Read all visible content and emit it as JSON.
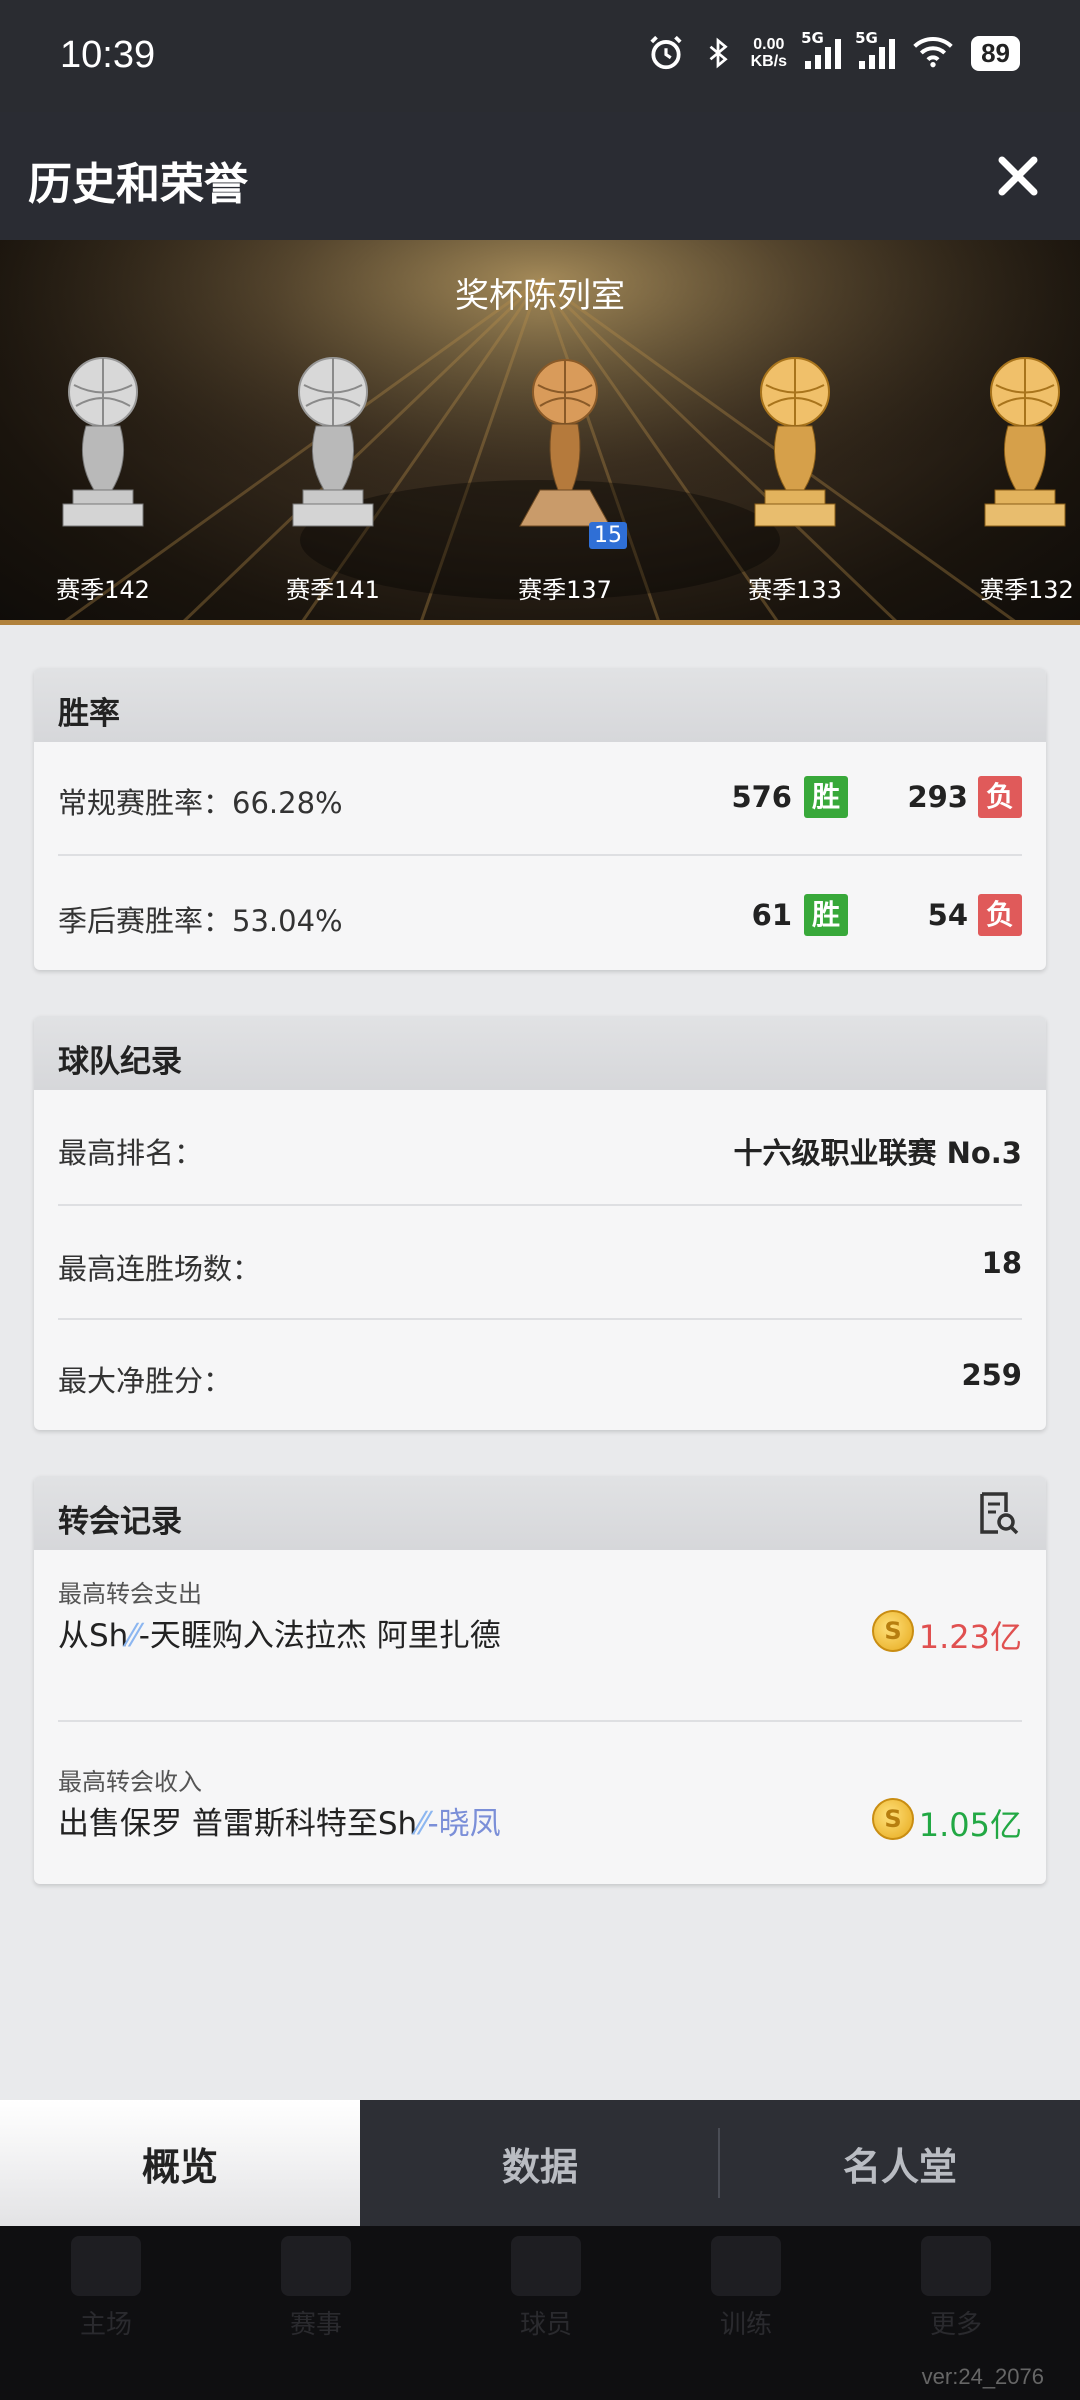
{
  "status": {
    "time": "10:39",
    "net_speed_value": "0.00",
    "net_speed_unit": "KB/s",
    "sim1": "5G",
    "sim2": "5G",
    "battery": "89"
  },
  "header": {
    "title": "历史和荣誉"
  },
  "banner": {
    "title": "奖杯陈列室",
    "trophies": [
      {
        "label": "赛季142",
        "type": "silver"
      },
      {
        "label": "赛季141",
        "type": "silver"
      },
      {
        "label": "赛季137",
        "type": "bronze",
        "badge": "15"
      },
      {
        "label": "赛季133",
        "type": "gold"
      },
      {
        "label": "赛季132",
        "type": "gold"
      }
    ]
  },
  "winrate": {
    "title": "胜率",
    "rows": [
      {
        "label": "常规赛胜率：66.28%",
        "wins": "576",
        "win_tag": "胜",
        "losses": "293",
        "loss_tag": "负"
      },
      {
        "label": "季后赛胜率：53.04%",
        "wins": "61",
        "win_tag": "胜",
        "losses": "54",
        "loss_tag": "负"
      }
    ]
  },
  "records": {
    "title": "球队纪录",
    "rows": [
      {
        "label": "最高排名：",
        "value": "十六级职业联赛 No.3"
      },
      {
        "label": "最高连胜场数：",
        "value": "18"
      },
      {
        "label": "最大净胜分：",
        "value": "259"
      }
    ]
  },
  "transfers": {
    "title": "转会记录",
    "items": [
      {
        "caption": "最高转会支出",
        "text_a": "从Sh",
        "text_b": "-天睚购入法拉杰 阿里扎德",
        "amount": "1.23亿",
        "color": "#e05050"
      },
      {
        "caption": "最高转会收入",
        "text_a": "出售保罗 普雷斯科特至Sh",
        "text_b": "-晓凤",
        "amount": "1.05亿",
        "color": "#22a844"
      }
    ]
  },
  "tabs": [
    "概览",
    "数据",
    "名人堂"
  ],
  "bottom_nav": [
    "主场",
    "赛事",
    "球员",
    "训练",
    "更多"
  ],
  "version": "ver:24_2076"
}
